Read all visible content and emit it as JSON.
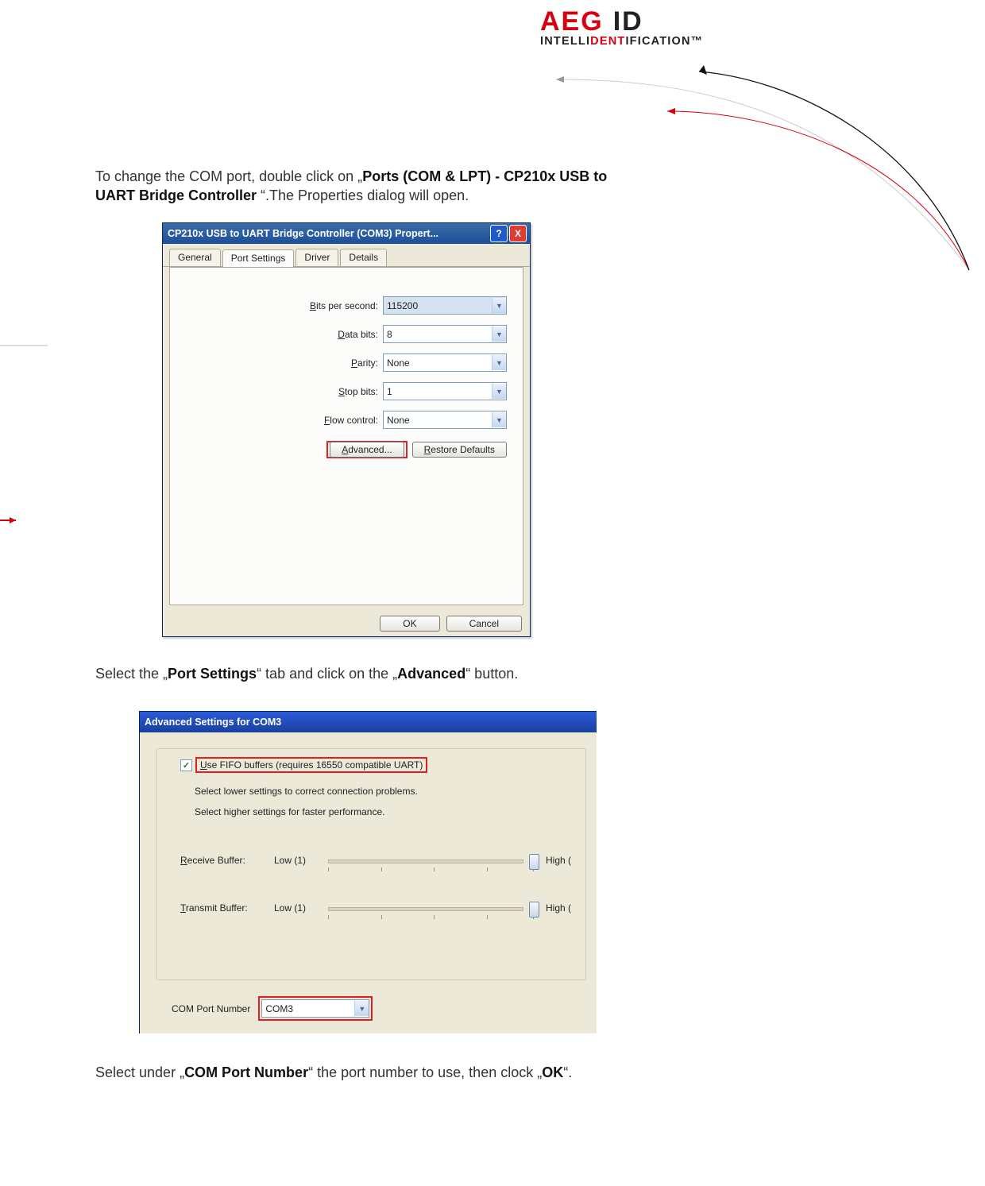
{
  "brand": {
    "a": "AEG",
    "b": "ID",
    "tag_pre": "INTELLI",
    "tag_mid": "DENT",
    "tag_post": "IFICATION™"
  },
  "para1": {
    "pre": "To change the COM port, double click on „",
    "b1": "Ports (COM & LPT) - CP210x USB to UART Bridge Controller",
    "post": " “.The Properties dialog will open."
  },
  "para2": {
    "pre": "Select the „",
    "b1": "Port Settings",
    "mid": "“ tab and click on the „",
    "b2": "Advanced",
    "post": "“ button."
  },
  "para3": {
    "pre": "Select under „",
    "b1": "COM Port Number",
    "mid": "“ the port number to use, then clock „",
    "b2": "OK",
    "post": "“."
  },
  "dlg1": {
    "title": "CP210x USB to UART Bridge Controller (COM3) Propert...",
    "tabs": {
      "general": "General",
      "port": "Port Settings",
      "driver": "Driver",
      "details": "Details"
    },
    "rows": {
      "bps_lbl_u": "B",
      "bps_lbl": "its per second:",
      "bps_val": "115200",
      "data_lbl_u": "D",
      "data_lbl": "ata bits:",
      "data_val": "8",
      "parity_lbl_u": "P",
      "parity_lbl": "arity:",
      "parity_val": "None",
      "stop_lbl_u": "S",
      "stop_lbl": "top bits:",
      "stop_val": "1",
      "flow_lbl_u": "F",
      "flow_lbl": "low control:",
      "flow_val": "None"
    },
    "adv_u": "A",
    "adv": "dvanced...",
    "rest_u": "R",
    "rest": "estore Defaults",
    "ok": "OK",
    "cancel": "Cancel"
  },
  "dlg2": {
    "title": "Advanced Settings for COM3",
    "fifo_u": "U",
    "fifo": "se FIFO buffers (requires 16550 compatible UART)",
    "hint1": "Select lower settings to correct connection problems.",
    "hint2": "Select higher settings for faster performance.",
    "recv_u": "R",
    "recv_lbl": "eceive Buffer:",
    "xmit_u": "T",
    "xmit_lbl": "ransmit Buffer:",
    "low": "Low (1)",
    "high": "High (",
    "comport_lbl": "COM Port Number",
    "comport_val": "COM3"
  }
}
